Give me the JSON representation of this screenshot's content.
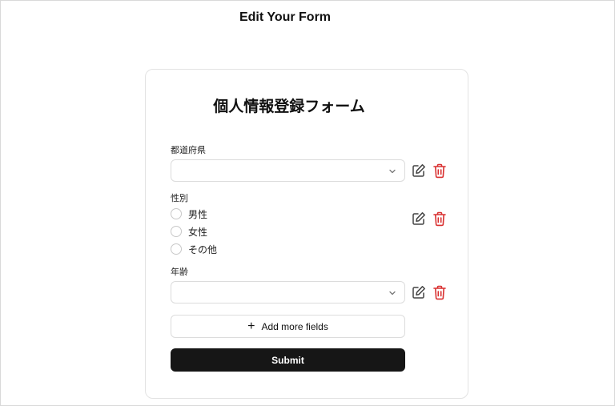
{
  "page": {
    "title": "Edit Your Form"
  },
  "form": {
    "title": "個人情報登録フォーム",
    "fields": [
      {
        "label": "都道府県",
        "type": "select",
        "value": ""
      },
      {
        "label": "性別",
        "type": "radio",
        "options": [
          "男性",
          "女性",
          "その他"
        ]
      },
      {
        "label": "年齢",
        "type": "select",
        "value": ""
      }
    ],
    "add_label": "Add more fields",
    "submit_label": "Submit"
  },
  "colors": {
    "primary_button": "#161616",
    "delete_icon": "#d93030",
    "edit_icon": "#444444",
    "border": "#dcdcdc"
  },
  "icons": {
    "edit": "edit-icon",
    "delete": "trash-icon",
    "chevron": "chevron-down-icon",
    "add": "plus-icon"
  }
}
